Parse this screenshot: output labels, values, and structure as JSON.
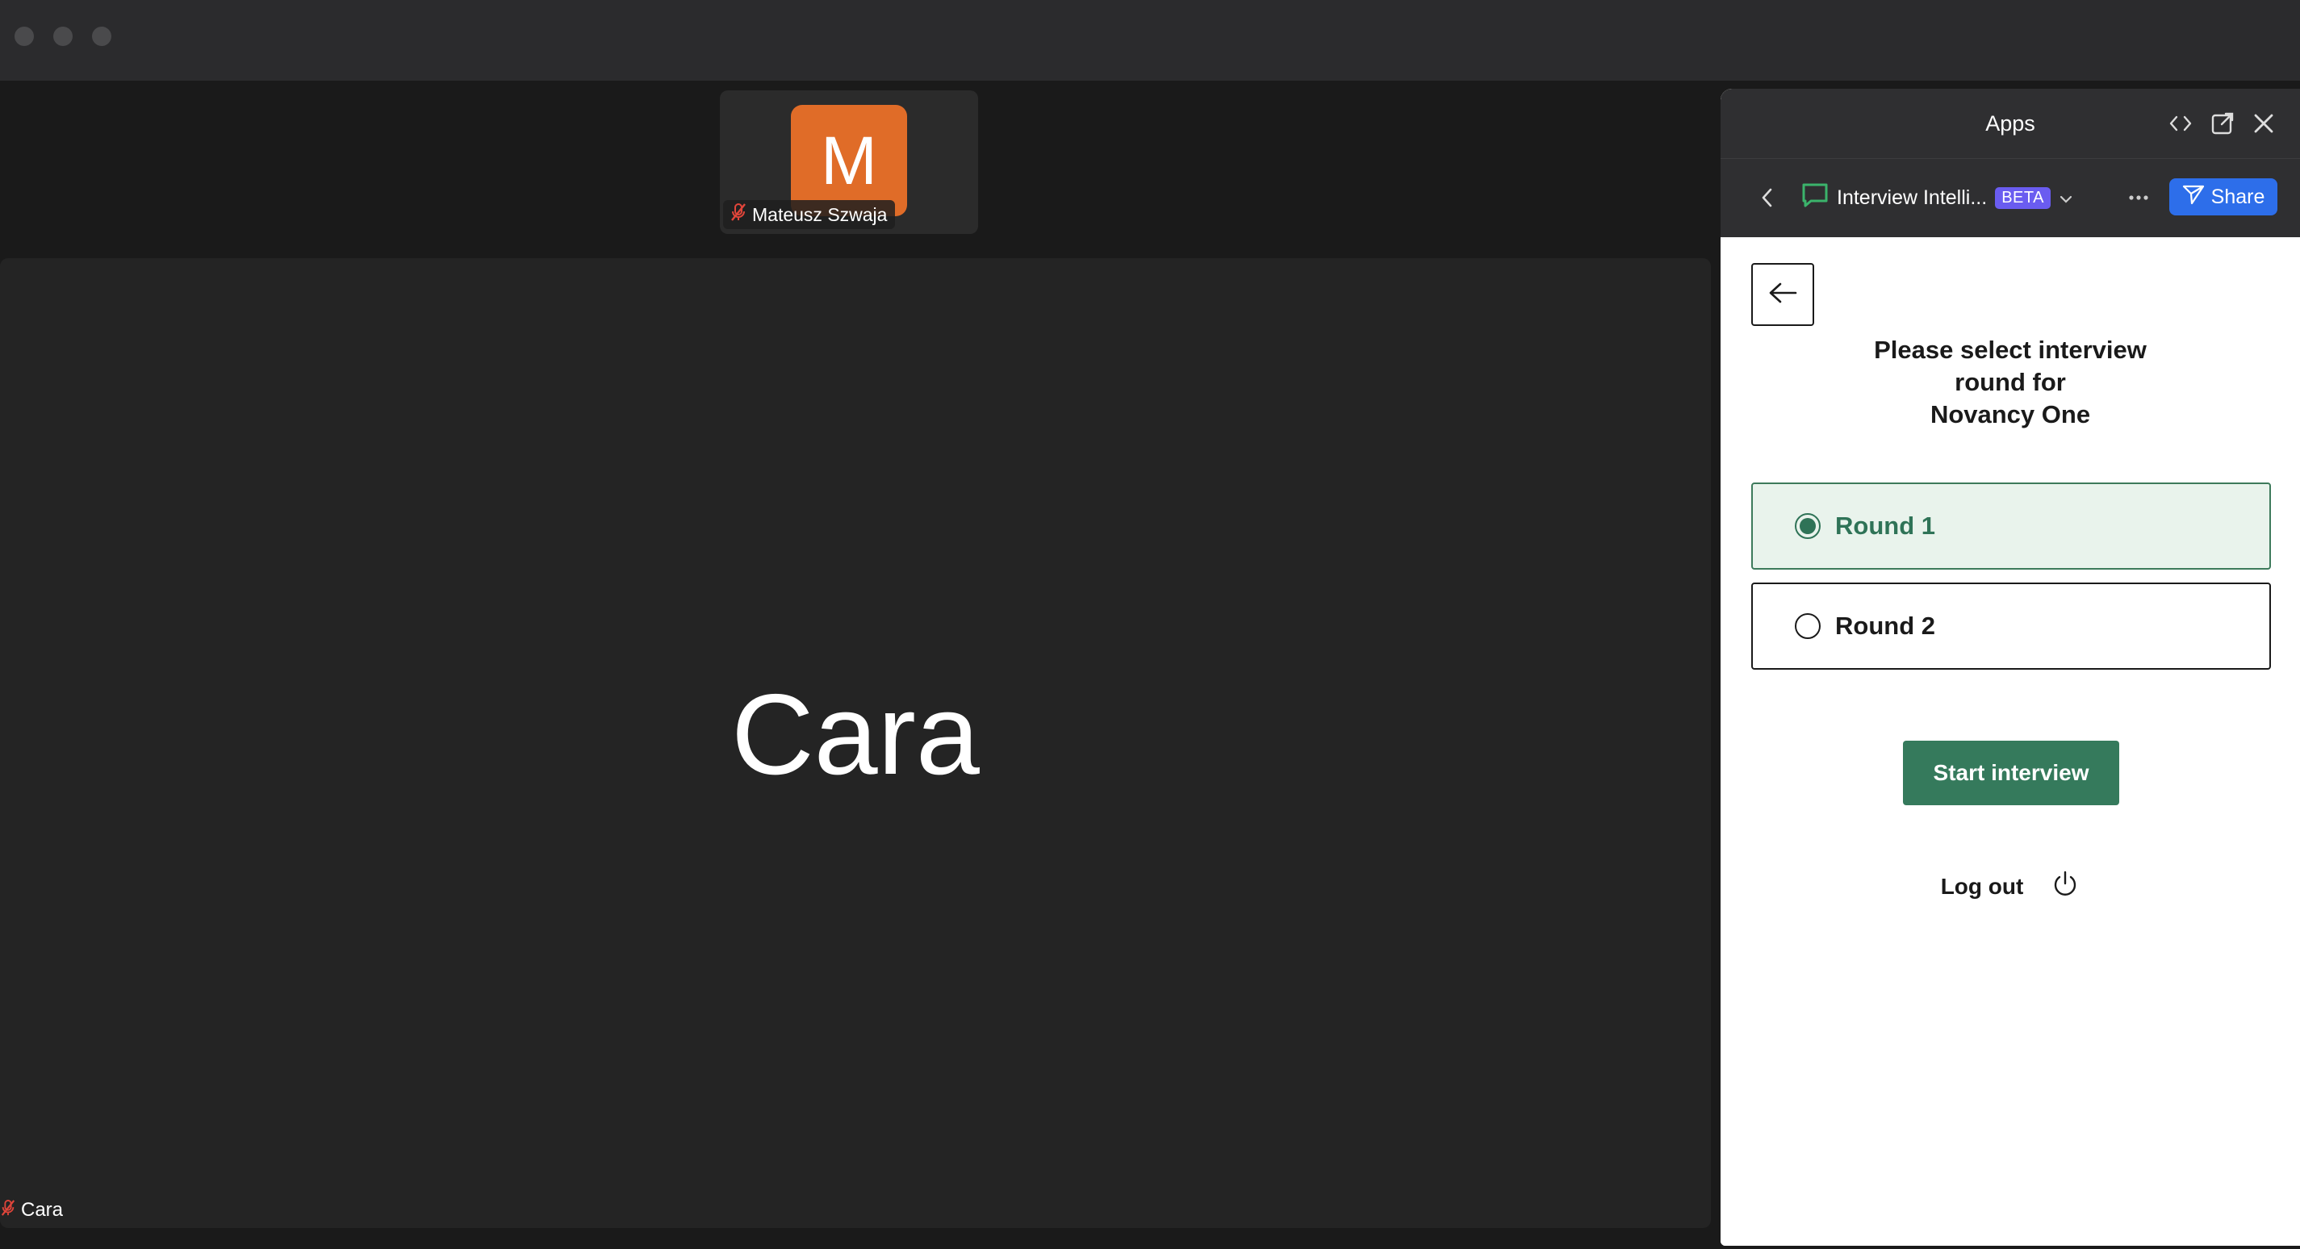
{
  "participants": {
    "thumbnail": {
      "initial": "M",
      "name": "Mateusz Szwaja",
      "avatar_color": "#e06c28"
    },
    "speaker": {
      "display_name": "Cara",
      "tag_name": "Cara"
    }
  },
  "apps_panel": {
    "title": "Apps",
    "app_name": "Interview Intelli...",
    "badge": "BETA",
    "share_label": "Share",
    "heading_lines": [
      "Please select interview",
      "round for",
      "Novancy One"
    ],
    "rounds": [
      {
        "label": "Round 1",
        "selected": true
      },
      {
        "label": "Round 2",
        "selected": false
      }
    ],
    "start_label": "Start interview",
    "logout_label": "Log out"
  },
  "colors": {
    "accent_green": "#357a5c",
    "share_blue": "#2d6eea",
    "beta_purple": "#6a5cf0",
    "muted_red": "#e0453a"
  }
}
